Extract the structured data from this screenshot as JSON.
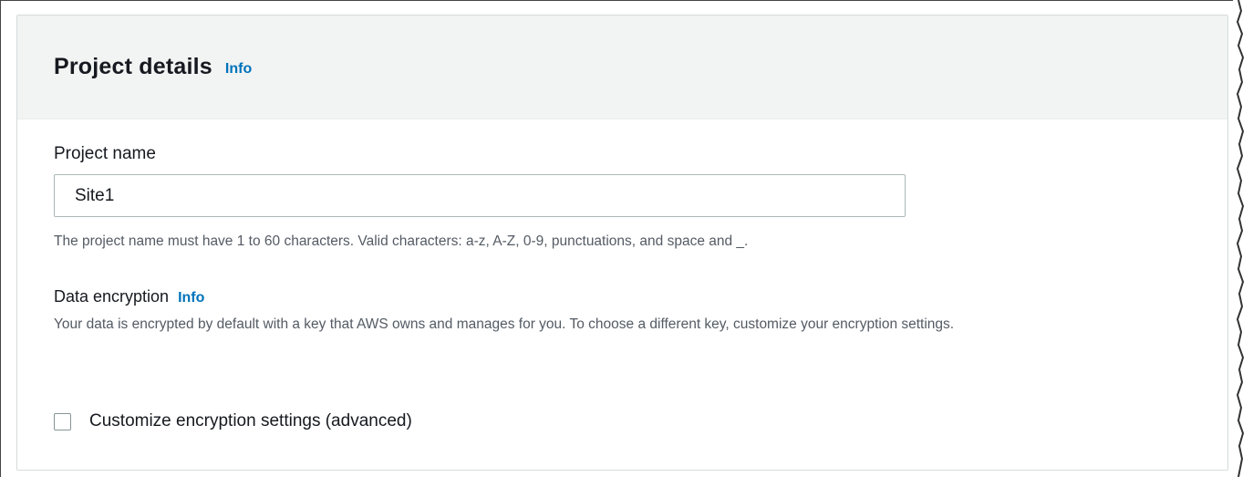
{
  "panel": {
    "title": "Project details",
    "info_label": "Info"
  },
  "project_name": {
    "label": "Project name",
    "value": "Site1",
    "helper": "The project name must have 1 to 60 characters. Valid characters: a-z, A-Z, 0-9, punctuations, and space and _."
  },
  "data_encryption": {
    "label": "Data encryption",
    "info_label": "Info",
    "description": "Your data is encrypted by default with a key that AWS owns and manages for you. To choose a different key, customize your encryption settings."
  },
  "customize_checkbox": {
    "label": "Customize encryption settings (advanced)",
    "checked": false
  },
  "colors": {
    "link": "#0073bb",
    "header_bg": "#f2f3f3",
    "border": "#d5dbdb",
    "text": "#16191f",
    "secondary_text": "#545b64"
  }
}
